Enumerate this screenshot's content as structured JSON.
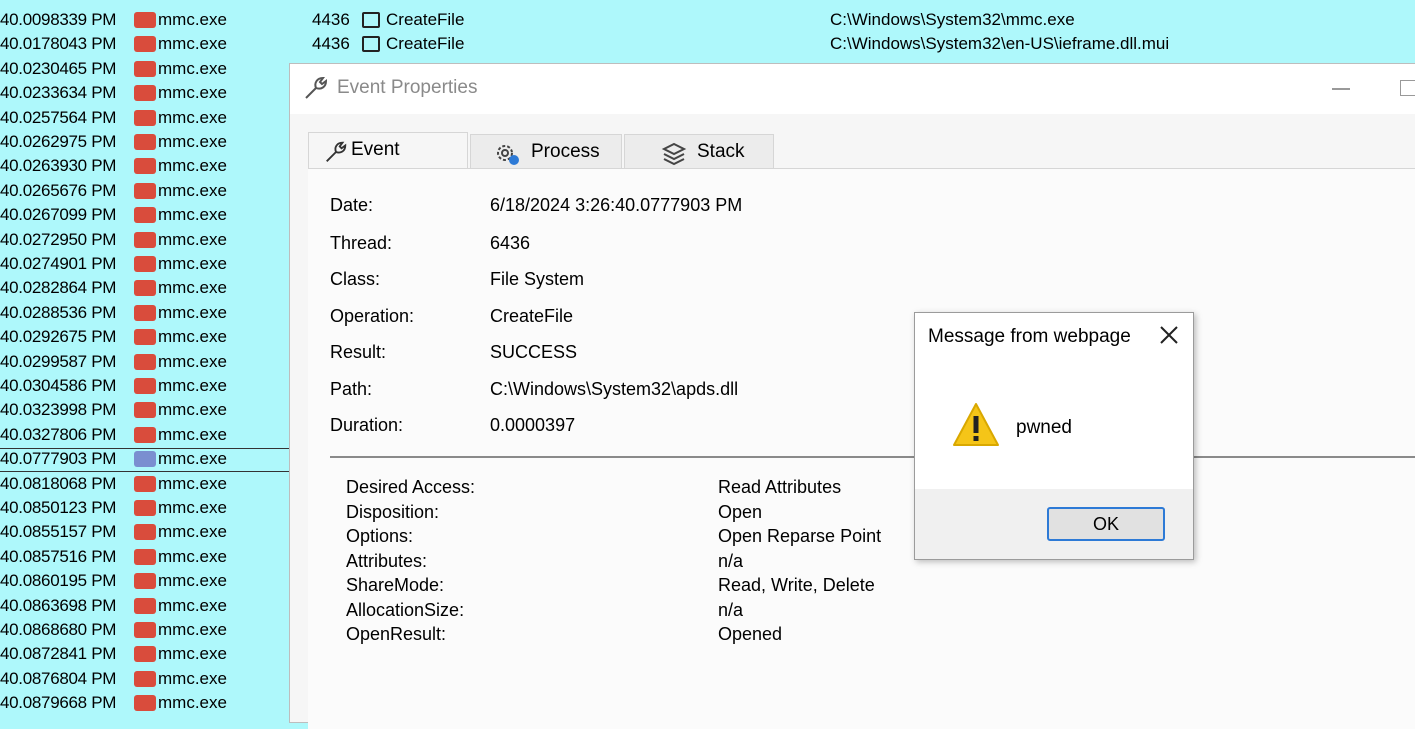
{
  "background_list": {
    "top_rows": [
      {
        "pid": "4436",
        "operation": "CreateFile",
        "path": "C:\\Windows\\System32\\mmc.exe"
      },
      {
        "pid": "4436",
        "operation": "CreateFile",
        "path": "C:\\Windows\\System32\\en-US\\ieframe.dll.mui"
      }
    ],
    "process": "mmc.exe",
    "times": [
      "40.0098339 PM",
      "40.0178043 PM",
      "40.0230465 PM",
      "40.0233634 PM",
      "40.0257564 PM",
      "40.0262975 PM",
      "40.0263930 PM",
      "40.0265676 PM",
      "40.0267099 PM",
      "40.0272950 PM",
      "40.0274901 PM",
      "40.0282864 PM",
      "40.0288536 PM",
      "40.0292675 PM",
      "40.0299587 PM",
      "40.0304586 PM",
      "40.0323998 PM",
      "40.0327806 PM",
      "40.0777903 PM",
      "40.0818068 PM",
      "40.0850123 PM",
      "40.0855157 PM",
      "40.0857516 PM",
      "40.0860195 PM",
      "40.0863698 PM",
      "40.0868680 PM",
      "40.0872841 PM",
      "40.0876804 PM",
      "40.0879668 PM"
    ],
    "selected_time": "40.0777903 PM"
  },
  "window": {
    "title": "Event Properties",
    "icon": "wrench-icon",
    "tabs": [
      {
        "label": "Event",
        "icon": "wrench-icon"
      },
      {
        "label": "Process",
        "icon": "gear-icon"
      },
      {
        "label": "Stack",
        "icon": "stack-icon"
      }
    ],
    "fields": [
      {
        "label": "Date:",
        "value": "6/18/2024 3:26:40.0777903 PM"
      },
      {
        "label": "Thread:",
        "value": "6436"
      },
      {
        "label": "Class:",
        "value": "File System"
      },
      {
        "label": "Operation:",
        "value": "CreateFile"
      },
      {
        "label": "Result:",
        "value": "SUCCESS"
      },
      {
        "label": "Path:",
        "value": "C:\\Windows\\System32\\apds.dll"
      },
      {
        "label": "Duration:",
        "value": "0.0000397"
      }
    ],
    "details": [
      {
        "label": "Desired Access:",
        "value": "Read Attributes"
      },
      {
        "label": "Disposition:",
        "value": "Open"
      },
      {
        "label": "Options:",
        "value": "Open Reparse Point"
      },
      {
        "label": "Attributes:",
        "value": "n/a"
      },
      {
        "label": "ShareMode:",
        "value": "Read, Write, Delete"
      },
      {
        "label": "AllocationSize:",
        "value": "n/a"
      },
      {
        "label": "OpenResult:",
        "value": "Opened"
      }
    ]
  },
  "message_box": {
    "title": "Message from webpage",
    "text": "pwned",
    "ok_label": "OK",
    "icon": "warning-icon"
  },
  "colors": {
    "list_background": "#aef8fb",
    "process_icon": "#d94c3c",
    "ok_border": "#2d7ad6",
    "warning": "#f5c518"
  }
}
